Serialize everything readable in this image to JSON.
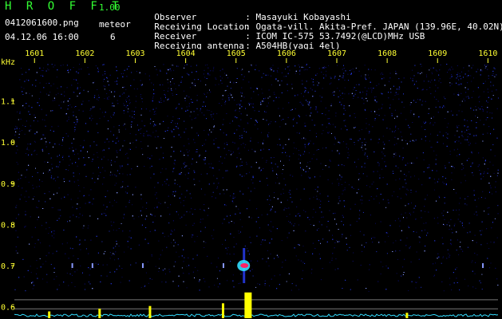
{
  "header": {
    "app_title": "H R O F F T",
    "version": "1.00",
    "file_name": "0412061600.png",
    "timestamp": "04.12.06 16:00",
    "meteor_label": "meteor",
    "meteor_count": "6"
  },
  "station": [
    {
      "key": "Observer",
      "value": ": Masayuki Kobayashi"
    },
    {
      "key": "Receiving Location",
      "value": ": Ogata-vill. Akita-Pref. JAPAN (139.96E, 40.02N)"
    },
    {
      "key": "Receiver",
      "value": ": ICOM IC-575 53.7492(@LCD)MHz USB"
    },
    {
      "key": "Receiving antenna",
      "value": ": A504HB(yagi 4el)"
    }
  ],
  "colors": {
    "background": "#000000",
    "noise_dark": "#0a0a5a",
    "noise_mid": "#2233cc",
    "noise_bright": "#8899ff",
    "tick_label": "#ffff33",
    "header_green": "#33ff33",
    "meteor_core": "#ff2266",
    "meteor_halo": "#33ddff",
    "spectrum": "#33ddff",
    "spectrum_peak": "#ffff00"
  },
  "chart_data": {
    "type": "heatmap",
    "y_unit": "kHz",
    "x_ticks": [
      "1601",
      "1602",
      "1603",
      "1604",
      "1605",
      "1606",
      "1607",
      "1608",
      "1609",
      "1610"
    ],
    "y_ticks": [
      "1.1",
      "1.0",
      "0.9",
      "0.8",
      "0.7",
      "0.6"
    ],
    "y_range": [
      0.58,
      1.19
    ],
    "x_range": [
      1600.6,
      1610.2
    ],
    "meteors": [
      {
        "x": 1605.15,
        "y": 0.7,
        "strength": "strong"
      },
      {
        "x": 1604.75,
        "y": 0.7,
        "strength": "weak"
      },
      {
        "x": 1603.15,
        "y": 0.7,
        "strength": "weak"
      },
      {
        "x": 1601.75,
        "y": 0.7,
        "strength": "weak"
      },
      {
        "x": 1602.15,
        "y": 0.7,
        "strength": "weak"
      },
      {
        "x": 1609.9,
        "y": 0.7,
        "strength": "weak"
      }
    ],
    "spectrum_peaks": [
      {
        "x": 1605.2,
        "level": 0.95
      },
      {
        "x": 1604.75,
        "level": 0.55
      },
      {
        "x": 1603.3,
        "level": 0.45
      },
      {
        "x": 1602.3,
        "level": 0.35
      },
      {
        "x": 1601.3,
        "level": 0.25
      },
      {
        "x": 1608.4,
        "level": 0.2
      }
    ]
  }
}
